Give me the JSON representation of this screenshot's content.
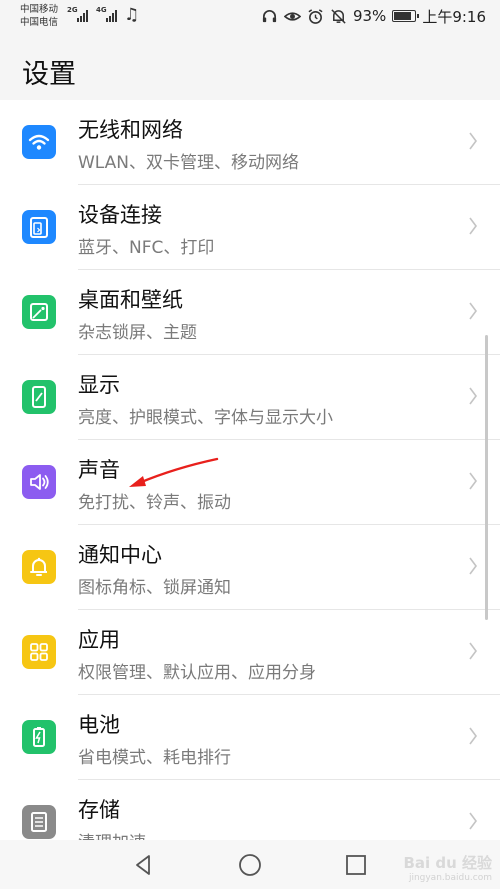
{
  "status_bar": {
    "carrier_1": "中国移动",
    "carrier_2": "中国电信",
    "net_1": "2G",
    "net_2": "4G",
    "battery": "93%",
    "time": "上午9:16",
    "battery_level": 0.93
  },
  "header": {
    "title": "设置"
  },
  "items": [
    {
      "title": "无线和网络",
      "subtitle": "WLAN、双卡管理、移动网络",
      "icon": "wifi-icon",
      "color": "#1e88ff"
    },
    {
      "title": "设备连接",
      "subtitle": "蓝牙、NFC、打印",
      "icon": "device-connection-icon",
      "color": "#1e88ff"
    },
    {
      "title": "桌面和壁纸",
      "subtitle": "杂志锁屏、主题",
      "icon": "wallpaper-icon",
      "color": "#22c26b"
    },
    {
      "title": "显示",
      "subtitle": "亮度、护眼模式、字体与显示大小",
      "icon": "display-icon",
      "color": "#22c26b"
    },
    {
      "title": "声音",
      "subtitle": "免打扰、铃声、振动",
      "icon": "sound-icon",
      "color": "#8c5cf0"
    },
    {
      "title": "通知中心",
      "subtitle": "图标角标、锁屏通知",
      "icon": "bell-icon",
      "color": "#f6c613"
    },
    {
      "title": "应用",
      "subtitle": "权限管理、默认应用、应用分身",
      "icon": "apps-grid-icon",
      "color": "#f6c613"
    },
    {
      "title": "电池",
      "subtitle": "省电模式、耗电排行",
      "icon": "battery-icon",
      "color": "#22c26b"
    },
    {
      "title": "存储",
      "subtitle": "清理加速",
      "icon": "storage-icon",
      "color": "#8a8a8a"
    }
  ],
  "watermark": {
    "brand": "Bai du 经验",
    "url": "jingyan.baidu.com"
  }
}
